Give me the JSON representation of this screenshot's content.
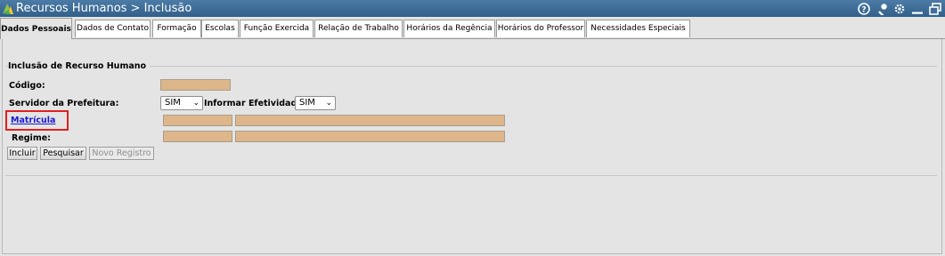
{
  "header": {
    "title": "Recursos Humanos > Inclusão",
    "tools": [
      "help-icon",
      "key-icon",
      "gear-icon",
      "minimize-icon",
      "restore-icon"
    ]
  },
  "tabs": [
    {
      "label": "Dados Pessoais",
      "active": true
    },
    {
      "label": "Dados de Contato"
    },
    {
      "label": "Formação"
    },
    {
      "label": "Escolas"
    },
    {
      "label": "Função Exercida"
    },
    {
      "label": "Relação de Trabalho"
    },
    {
      "label": "Horários da Regência"
    },
    {
      "label": "Horários do Professor"
    },
    {
      "label": "Necessidades Especiais"
    }
  ],
  "form": {
    "legend": "Inclusão de Recurso Humano",
    "codigo_label": "Código:",
    "servidor_label": "Servidor da Prefeitura:",
    "servidor_value": "SIM",
    "efetividade_label": "Informar Efetividade:",
    "efetividade_value": "SIM",
    "matricula_label": "Matrícula",
    "regime_label": "Regime:"
  },
  "buttons": {
    "incluir": "Incluir",
    "pesquisar": "Pesquisar",
    "novo_registro": "Novo Registro"
  },
  "colors": {
    "titlebar": "#3f6e9a",
    "field_fill": "#ddb689",
    "highlight": "#e02020",
    "link": "#1a1ad1"
  }
}
